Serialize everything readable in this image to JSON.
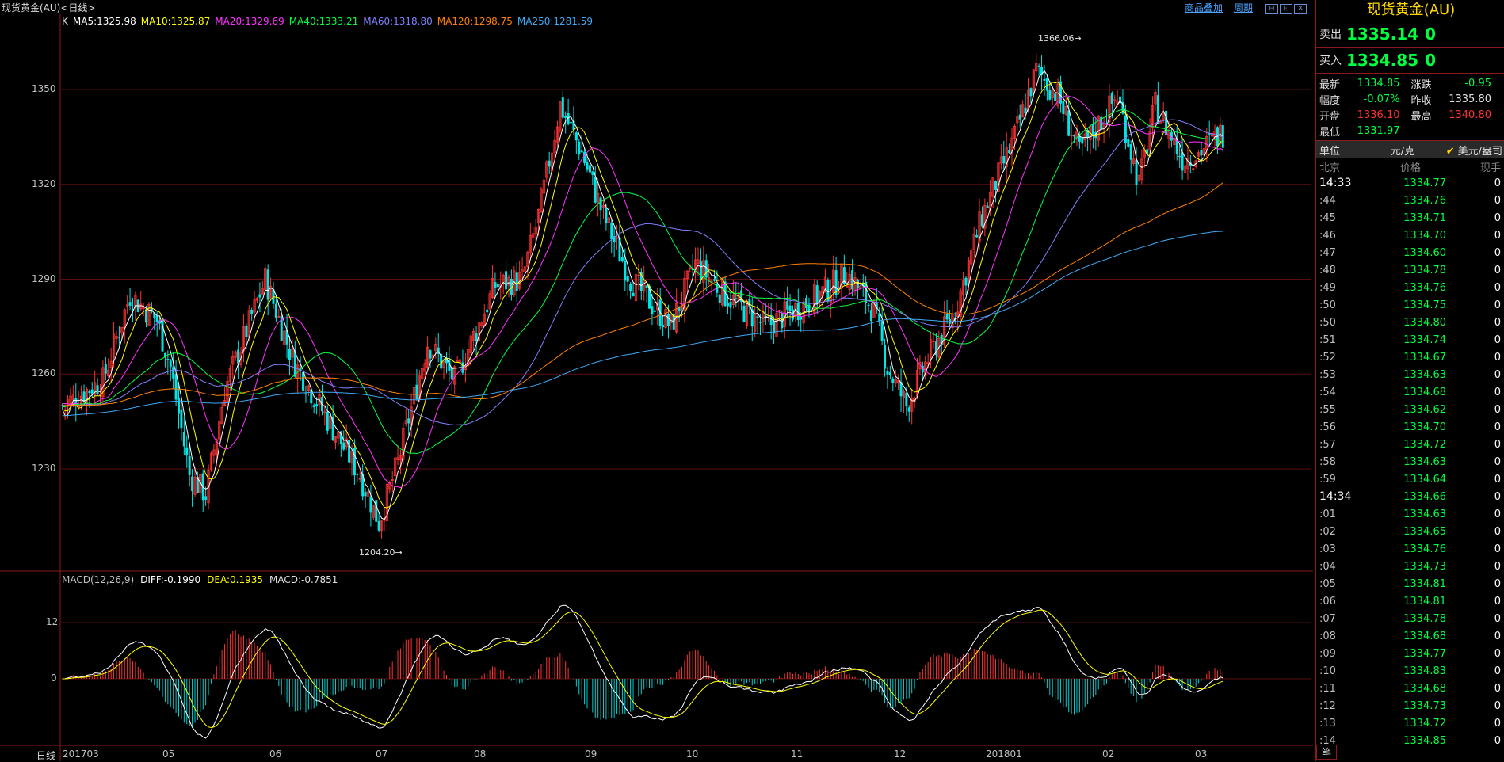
{
  "window": {
    "title": "现货黄金(AU)<日线>",
    "links": [
      "商品叠加",
      "周期"
    ],
    "buttons": [
      "⊟",
      "⊡",
      "✕"
    ]
  },
  "ma_legend": [
    {
      "text": "K",
      "color": "#e0e0e0"
    },
    {
      "text": "MA5:1325.98",
      "color": "#ffffff"
    },
    {
      "text": "MA10:1325.87",
      "color": "#ffff00"
    },
    {
      "text": "MA20:1329.69",
      "color": "#ff33ff"
    },
    {
      "text": "MA40:1333.21",
      "color": "#00ff40"
    },
    {
      "text": "MA60:1318.80",
      "color": "#8080ff"
    },
    {
      "text": "MA120:1298.75",
      "color": "#ff8000"
    },
    {
      "text": "MA250:1281.59",
      "color": "#3fa9f5"
    }
  ],
  "macd_legend": [
    {
      "text": "MACD(12,26,9)",
      "color": "#c0c0c0"
    },
    {
      "text": "DIFF:-0.1990",
      "color": "#ffffff"
    },
    {
      "text": "DEA:0.1935",
      "color": "#ffff00"
    },
    {
      "text": "MACD:-0.7851",
      "color": "#e0e0e0"
    }
  ],
  "callouts": {
    "high": "1366.06",
    "low": "1204.20"
  },
  "period_label": "日线",
  "chart_data": [
    {
      "type": "candlestick",
      "title": "现货黄金(AU)<日线>",
      "y_ticks": [
        1230,
        1260,
        1290,
        1320,
        1350
      ],
      "ylim": [
        1195,
        1370
      ],
      "x_ticks": [
        "201703",
        "05",
        "06",
        "07",
        "08",
        "09",
        "10",
        "11",
        "12",
        "201801",
        "02",
        "03"
      ],
      "waypoints": [
        [
          0,
          1250
        ],
        [
          15,
          1258
        ],
        [
          25,
          1285
        ],
        [
          35,
          1277
        ],
        [
          40,
          1262
        ],
        [
          47,
          1228
        ],
        [
          53,
          1222
        ],
        [
          60,
          1255
        ],
        [
          75,
          1290
        ],
        [
          85,
          1265
        ],
        [
          95,
          1250
        ],
        [
          110,
          1228
        ],
        [
          117,
          1213
        ],
        [
          124,
          1232
        ],
        [
          135,
          1270
        ],
        [
          145,
          1258
        ],
        [
          160,
          1288
        ],
        [
          170,
          1290
        ],
        [
          176,
          1310
        ],
        [
          184,
          1345
        ],
        [
          192,
          1330
        ],
        [
          200,
          1310
        ],
        [
          210,
          1290
        ],
        [
          225,
          1275
        ],
        [
          234,
          1295
        ],
        [
          245,
          1285
        ],
        [
          260,
          1275
        ],
        [
          280,
          1285
        ],
        [
          290,
          1292
        ],
        [
          300,
          1280
        ],
        [
          305,
          1262
        ],
        [
          312,
          1250
        ],
        [
          320,
          1265
        ],
        [
          330,
          1280
        ],
        [
          340,
          1310
        ],
        [
          352,
          1335
        ],
        [
          360,
          1356
        ],
        [
          368,
          1348
        ],
        [
          376,
          1330
        ],
        [
          390,
          1348
        ],
        [
          398,
          1320
        ],
        [
          404,
          1345
        ],
        [
          414,
          1328
        ],
        [
          420,
          1330
        ],
        [
          428,
          1336
        ]
      ],
      "grid": true
    },
    {
      "type": "macd",
      "y_ticks": [
        0,
        12
      ],
      "grid": true
    }
  ],
  "side": {
    "title": "现货黄金(AU)",
    "sell": {
      "label": "卖出",
      "price": "1335.14",
      "vol": "0"
    },
    "buy": {
      "label": "买入",
      "price": "1334.85",
      "vol": "0"
    },
    "stats": [
      [
        {
          "k": "最新",
          "v": "1334.85",
          "c": "#00ff40"
        },
        {
          "k": "涨跌",
          "v": "-0.95",
          "c": "#00ff40"
        }
      ],
      [
        {
          "k": "幅度",
          "v": "-0.07%",
          "c": "#00ff40"
        },
        {
          "k": "昨收",
          "v": "1335.80",
          "c": "#e0e0e0"
        }
      ],
      [
        {
          "k": "开盘",
          "v": "1336.10",
          "c": "#ff3030"
        },
        {
          "k": "最高",
          "v": "1340.80",
          "c": "#ff3030"
        }
      ],
      [
        {
          "k": "最低",
          "v": "1331.97",
          "c": "#00ff40"
        },
        {
          "k": "",
          "v": "",
          "c": "#e0e0e0"
        }
      ]
    ],
    "unit": {
      "label": "单位",
      "cny": "元/克",
      "usd": "美元/盎司"
    },
    "tick_head": [
      "北京",
      "价格",
      "现手"
    ],
    "ticks": [
      {
        "t": "14:33",
        "full": true,
        "p": "1334.77",
        "q": "0"
      },
      {
        "t": ":44",
        "p": "1334.76",
        "q": "0"
      },
      {
        "t": ":45",
        "p": "1334.71",
        "q": "0"
      },
      {
        "t": ":46",
        "p": "1334.70",
        "q": "0"
      },
      {
        "t": ":47",
        "p": "1334.60",
        "q": "0"
      },
      {
        "t": ":48",
        "p": "1334.78",
        "q": "0"
      },
      {
        "t": ":49",
        "p": "1334.76",
        "q": "0"
      },
      {
        "t": ":50",
        "p": "1334.75",
        "q": "0"
      },
      {
        "t": ":50",
        "p": "1334.80",
        "q": "0"
      },
      {
        "t": ":51",
        "p": "1334.74",
        "q": "0"
      },
      {
        "t": ":52",
        "p": "1334.67",
        "q": "0"
      },
      {
        "t": ":53",
        "p": "1334.63",
        "q": "0"
      },
      {
        "t": ":54",
        "p": "1334.68",
        "q": "0"
      },
      {
        "t": ":55",
        "p": "1334.62",
        "q": "0"
      },
      {
        "t": ":56",
        "p": "1334.70",
        "q": "0"
      },
      {
        "t": ":57",
        "p": "1334.72",
        "q": "0"
      },
      {
        "t": ":58",
        "p": "1334.63",
        "q": "0"
      },
      {
        "t": ":59",
        "p": "1334.64",
        "q": "0"
      },
      {
        "t": "14:34",
        "full": true,
        "p": "1334.66",
        "q": "0"
      },
      {
        "t": ":01",
        "p": "1334.63",
        "q": "0"
      },
      {
        "t": ":02",
        "p": "1334.65",
        "q": "0"
      },
      {
        "t": ":03",
        "p": "1334.76",
        "q": "0"
      },
      {
        "t": ":04",
        "p": "1334.73",
        "q": "0"
      },
      {
        "t": ":05",
        "p": "1334.81",
        "q": "0"
      },
      {
        "t": ":06",
        "p": "1334.81",
        "q": "0"
      },
      {
        "t": ":07",
        "p": "1334.78",
        "q": "0"
      },
      {
        "t": ":08",
        "p": "1334.68",
        "q": "0"
      },
      {
        "t": ":09",
        "p": "1334.77",
        "q": "0"
      },
      {
        "t": ":10",
        "p": "1334.83",
        "q": "0"
      },
      {
        "t": ":11",
        "p": "1334.68",
        "q": "0"
      },
      {
        "t": ":12",
        "p": "1334.73",
        "q": "0"
      },
      {
        "t": ":13",
        "p": "1334.72",
        "q": "0"
      },
      {
        "t": ":14",
        "p": "1334.85",
        "q": "0"
      }
    ],
    "bottom_tab": "笔"
  }
}
